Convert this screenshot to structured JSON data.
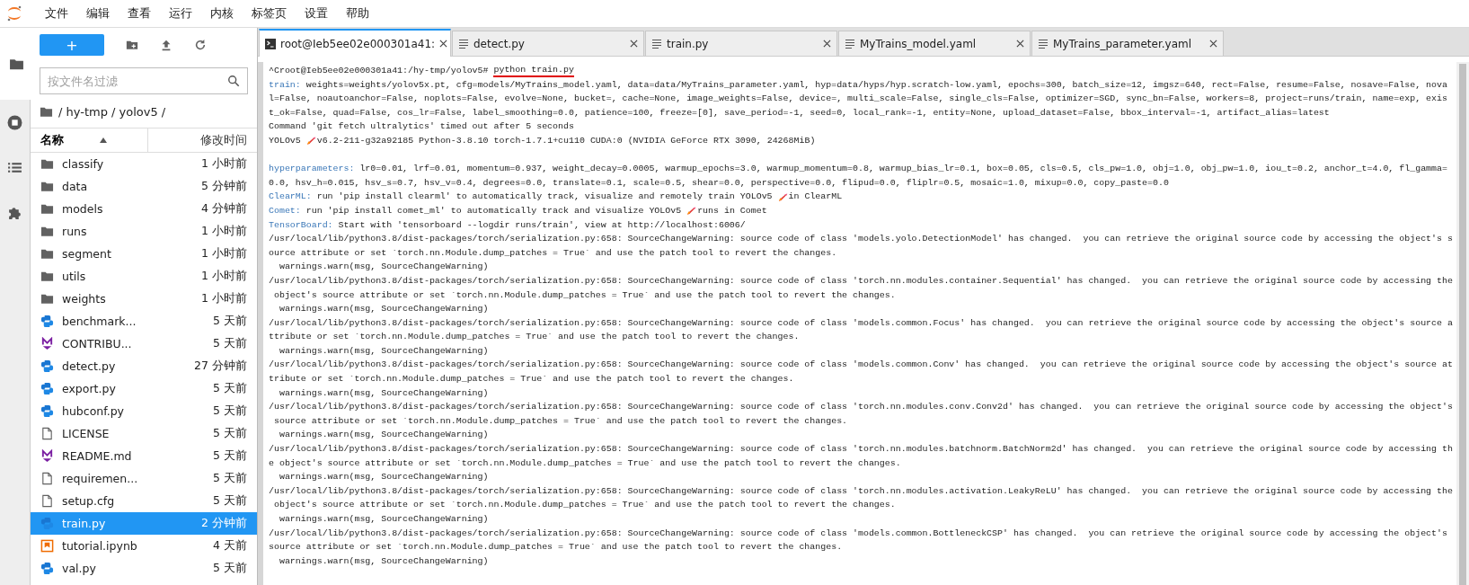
{
  "menu_bar": {
    "items": [
      "文件",
      "编辑",
      "查看",
      "运行",
      "内核",
      "标签页",
      "设置",
      "帮助"
    ]
  },
  "left_sidebar": {
    "items": [
      {
        "kind": "folder",
        "selected": true
      },
      {
        "kind": "stop",
        "selected": false
      },
      {
        "kind": "list",
        "selected": false
      },
      {
        "kind": "puzzle",
        "selected": false
      }
    ]
  },
  "file_browser": {
    "new_button": "+",
    "filter": {
      "placeholder": "按文件名过滤"
    },
    "breadcrumb": "/ hy-tmp / yolov5 /",
    "columns": {
      "name": "名称",
      "modified": "修改时间"
    },
    "files": [
      {
        "name": "classify",
        "modified": "1 小时前",
        "kind": "folder",
        "selected": false
      },
      {
        "name": "data",
        "modified": "5 分钟前",
        "kind": "folder",
        "selected": false
      },
      {
        "name": "models",
        "modified": "4 分钟前",
        "kind": "folder",
        "selected": false
      },
      {
        "name": "runs",
        "modified": "1 小时前",
        "kind": "folder",
        "selected": false
      },
      {
        "name": "segment",
        "modified": "1 小时前",
        "kind": "folder",
        "selected": false
      },
      {
        "name": "utils",
        "modified": "1 小时前",
        "kind": "folder",
        "selected": false
      },
      {
        "name": "weights",
        "modified": "1 小时前",
        "kind": "folder",
        "selected": false
      },
      {
        "name": "benchmark...",
        "modified": "5 天前",
        "kind": "python",
        "selected": false
      },
      {
        "name": "CONTRIBU...",
        "modified": "5 天前",
        "kind": "markdown",
        "selected": false
      },
      {
        "name": "detect.py",
        "modified": "27 分钟前",
        "kind": "python",
        "selected": false
      },
      {
        "name": "export.py",
        "modified": "5 天前",
        "kind": "python",
        "selected": false
      },
      {
        "name": "hubconf.py",
        "modified": "5 天前",
        "kind": "python",
        "selected": false
      },
      {
        "name": "LICENSE",
        "modified": "5 天前",
        "kind": "file",
        "selected": false
      },
      {
        "name": "README.md",
        "modified": "5 天前",
        "kind": "markdown",
        "selected": false
      },
      {
        "name": "requiremen...",
        "modified": "5 天前",
        "kind": "file",
        "selected": false
      },
      {
        "name": "setup.cfg",
        "modified": "5 天前",
        "kind": "file",
        "selected": false
      },
      {
        "name": "train.py",
        "modified": "2 分钟前",
        "kind": "python",
        "selected": true
      },
      {
        "name": "tutorial.ipynb",
        "modified": "4 天前",
        "kind": "notebook",
        "selected": false
      },
      {
        "name": "val.py",
        "modified": "5 天前",
        "kind": "python",
        "selected": false
      }
    ]
  },
  "tabs": [
    {
      "label": "root@Ieb5ee02e000301a41:",
      "kind": "terminal",
      "selected": true
    },
    {
      "label": "detect.py",
      "kind": "file",
      "selected": false
    },
    {
      "label": "train.py",
      "kind": "file",
      "selected": false
    },
    {
      "label": "MyTrains_model.yaml",
      "kind": "file",
      "selected": false
    },
    {
      "label": "MyTrains_parameter.yaml",
      "kind": "file",
      "selected": false
    }
  ],
  "terminal": {
    "lines": [
      {
        "kind": "output",
        "segments": [
          {
            "kind": "text",
            "text": "^Croot@Ieb5ee02e000301a41:/hy-tmp/yolov5# "
          },
          {
            "kind": "text",
            "text": "python train.py",
            "underlined": true
          }
        ]
      },
      {
        "kind": "output",
        "segments": [
          {
            "kind": "label",
            "text": "train:"
          },
          {
            "kind": "text",
            "text": " weights=weights/yolov5x.pt, cfg=models/MyTrains_model.yaml, data=data/MyTrains_parameter.yaml, hyp=data/hyps/hyp.scratch-low.yaml, epochs=300, batch_size=12, imgsz=640, rect=False, resume=False, nosave=False, nova"
          }
        ]
      },
      {
        "kind": "output",
        "segments": [
          {
            "kind": "text",
            "text": "l=False, noautoanchor=False, noplots=False, evolve=None, bucket=, cache=None, image_weights=False, device=, multi_scale=False, single_cls=False, optimizer=SGD, sync_bn=False, workers=8, project=runs/train, name=exp, exis"
          }
        ]
      },
      {
        "kind": "output",
        "segments": [
          {
            "kind": "text",
            "text": "t_ok=False, quad=False, cos_lr=False, label_smoothing=0.0, patience=100, freeze=[0], save_period=-1, seed=0, local_rank=-1, entity=None, upload_dataset=False, bbox_interval=-1, artifact_alias=latest"
          }
        ]
      },
      {
        "kind": "output",
        "segments": [
          {
            "kind": "text",
            "text": "Command 'git fetch ultralytics' timed out after 5 seconds"
          }
        ]
      },
      {
        "kind": "output",
        "segments": [
          {
            "kind": "text",
            "text": "YOLOv5 "
          },
          {
            "kind": "rocket"
          },
          {
            "kind": "text",
            "text": "v6.2-211-g32a92185 Python-3.8.10 torch-1.7.1+cu110 CUDA:0 (NVIDIA GeForce RTX 3090, 24268MiB)"
          }
        ]
      },
      {
        "kind": "blank"
      },
      {
        "kind": "output",
        "segments": [
          {
            "kind": "label",
            "text": "hyperparameters:"
          },
          {
            "kind": "text",
            "text": " lr0=0.01, lrf=0.01, momentum=0.937, weight_decay=0.0005, warmup_epochs=3.0, warmup_momentum=0.8, warmup_bias_lr=0.1, box=0.05, cls=0.5, cls_pw=1.0, obj=1.0, obj_pw=1.0, iou_t=0.2, anchor_t=4.0, fl_gamma="
          }
        ]
      },
      {
        "kind": "output",
        "segments": [
          {
            "kind": "text",
            "text": "0.0, hsv_h=0.015, hsv_s=0.7, hsv_v=0.4, degrees=0.0, translate=0.1, scale=0.5, shear=0.0, perspective=0.0, flipud=0.0, fliplr=0.5, mosaic=1.0, mixup=0.0, copy_paste=0.0"
          }
        ]
      },
      {
        "kind": "output",
        "segments": [
          {
            "kind": "label",
            "text": "ClearML:"
          },
          {
            "kind": "text",
            "text": " run 'pip install clearml' to automatically track, visualize and remotely train YOLOv5 "
          },
          {
            "kind": "rocket"
          },
          {
            "kind": "text",
            "text": "in ClearML"
          }
        ]
      },
      {
        "kind": "output",
        "segments": [
          {
            "kind": "label",
            "text": "Comet:"
          },
          {
            "kind": "text",
            "text": " run 'pip install comet_ml' to automatically track and visualize YOLOv5 "
          },
          {
            "kind": "rocket"
          },
          {
            "kind": "text",
            "text": "runs in Comet"
          }
        ]
      },
      {
        "kind": "output",
        "segments": [
          {
            "kind": "label",
            "text": "TensorBoard:"
          },
          {
            "kind": "text",
            "text": " Start with 'tensorboard --logdir runs/train', view at http://localhost:6006/"
          }
        ]
      },
      {
        "kind": "output",
        "segments": [
          {
            "kind": "text",
            "text": "/usr/local/lib/python3.8/dist-packages/torch/serialization.py:658: SourceChangeWarning: source code of class 'models.yolo.DetectionModel' has changed.  you can retrieve the original source code by accessing the object's s"
          }
        ]
      },
      {
        "kind": "output",
        "segments": [
          {
            "kind": "text",
            "text": "ource attribute or set `torch.nn.Module.dump_patches = True` and use the patch tool to revert the changes."
          }
        ]
      },
      {
        "kind": "output",
        "segments": [
          {
            "kind": "text",
            "text": "  warnings.warn(msg, SourceChangeWarning)"
          }
        ]
      },
      {
        "kind": "output",
        "segments": [
          {
            "kind": "text",
            "text": "/usr/local/lib/python3.8/dist-packages/torch/serialization.py:658: SourceChangeWarning: source code of class 'torch.nn.modules.container.Sequential' has changed.  you can retrieve the original source code by accessing the"
          }
        ]
      },
      {
        "kind": "output",
        "segments": [
          {
            "kind": "text",
            "text": " object's source attribute or set `torch.nn.Module.dump_patches = True` and use the patch tool to revert the changes."
          }
        ]
      },
      {
        "kind": "output",
        "segments": [
          {
            "kind": "text",
            "text": "  warnings.warn(msg, SourceChangeWarning)"
          }
        ]
      },
      {
        "kind": "output",
        "segments": [
          {
            "kind": "text",
            "text": "/usr/local/lib/python3.8/dist-packages/torch/serialization.py:658: SourceChangeWarning: source code of class 'models.common.Focus' has changed.  you can retrieve the original source code by accessing the object's source a"
          }
        ]
      },
      {
        "kind": "output",
        "segments": [
          {
            "kind": "text",
            "text": "ttribute or set `torch.nn.Module.dump_patches = True` and use the patch tool to revert the changes."
          }
        ]
      },
      {
        "kind": "output",
        "segments": [
          {
            "kind": "text",
            "text": "  warnings.warn(msg, SourceChangeWarning)"
          }
        ]
      },
      {
        "kind": "output",
        "segments": [
          {
            "kind": "text",
            "text": "/usr/local/lib/python3.8/dist-packages/torch/serialization.py:658: SourceChangeWarning: source code of class 'models.common.Conv' has changed.  you can retrieve the original source code by accessing the object's source at"
          }
        ]
      },
      {
        "kind": "output",
        "segments": [
          {
            "kind": "text",
            "text": "tribute or set `torch.nn.Module.dump_patches = True` and use the patch tool to revert the changes."
          }
        ]
      },
      {
        "kind": "output",
        "segments": [
          {
            "kind": "text",
            "text": "  warnings.warn(msg, SourceChangeWarning)"
          }
        ]
      },
      {
        "kind": "output",
        "segments": [
          {
            "kind": "text",
            "text": "/usr/local/lib/python3.8/dist-packages/torch/serialization.py:658: SourceChangeWarning: source code of class 'torch.nn.modules.conv.Conv2d' has changed.  you can retrieve the original source code by accessing the object's"
          }
        ]
      },
      {
        "kind": "output",
        "segments": [
          {
            "kind": "text",
            "text": " source attribute or set `torch.nn.Module.dump_patches = True` and use the patch tool to revert the changes."
          }
        ]
      },
      {
        "kind": "output",
        "segments": [
          {
            "kind": "text",
            "text": "  warnings.warn(msg, SourceChangeWarning)"
          }
        ]
      },
      {
        "kind": "output",
        "segments": [
          {
            "kind": "text",
            "text": "/usr/local/lib/python3.8/dist-packages/torch/serialization.py:658: SourceChangeWarning: source code of class 'torch.nn.modules.batchnorm.BatchNorm2d' has changed.  you can retrieve the original source code by accessing th"
          }
        ]
      },
      {
        "kind": "output",
        "segments": [
          {
            "kind": "text",
            "text": "e object's source attribute or set `torch.nn.Module.dump_patches = True` and use the patch tool to revert the changes."
          }
        ]
      },
      {
        "kind": "output",
        "segments": [
          {
            "kind": "text",
            "text": "  warnings.warn(msg, SourceChangeWarning)"
          }
        ]
      },
      {
        "kind": "output",
        "segments": [
          {
            "kind": "text",
            "text": "/usr/local/lib/python3.8/dist-packages/torch/serialization.py:658: SourceChangeWarning: source code of class 'torch.nn.modules.activation.LeakyReLU' has changed.  you can retrieve the original source code by accessing the"
          }
        ]
      },
      {
        "kind": "output",
        "segments": [
          {
            "kind": "text",
            "text": " object's source attribute or set `torch.nn.Module.dump_patches = True` and use the patch tool to revert the changes."
          }
        ]
      },
      {
        "kind": "output",
        "segments": [
          {
            "kind": "text",
            "text": "  warnings.warn(msg, SourceChangeWarning)"
          }
        ]
      },
      {
        "kind": "output",
        "segments": [
          {
            "kind": "text",
            "text": "/usr/local/lib/python3.8/dist-packages/torch/serialization.py:658: SourceChangeWarning: source code of class 'models.common.BottleneckCSP' has changed.  you can retrieve the original source code by accessing the object's"
          }
        ]
      },
      {
        "kind": "output",
        "segments": [
          {
            "kind": "text",
            "text": "source attribute or set `torch.nn.Module.dump_patches = True` and use the patch tool to revert the changes."
          }
        ]
      },
      {
        "kind": "output",
        "segments": [
          {
            "kind": "text",
            "text": "  warnings.warn(msg, SourceChangeWarning)"
          }
        ]
      }
    ]
  }
}
